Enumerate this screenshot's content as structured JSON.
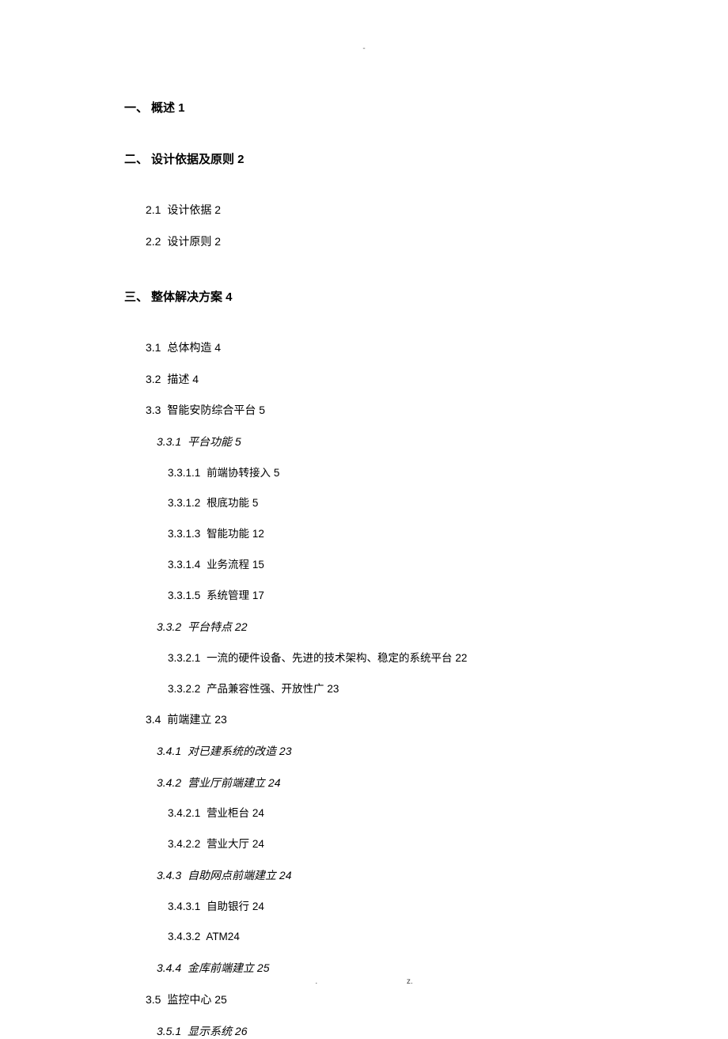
{
  "header": {
    "mark": "-"
  },
  "footer": {
    "dot": ".",
    "z": "z."
  },
  "toc": [
    {
      "level": "h1",
      "num": "一、",
      "title": "概述 1"
    },
    {
      "level": "h1",
      "num": "二、",
      "title": "设计依据及原则 2"
    },
    {
      "level": "l2",
      "num": "2.1",
      "title": "设计依据 2"
    },
    {
      "level": "l2",
      "num": "2.2",
      "title": "设计原则 2"
    },
    {
      "level": "h1",
      "num": "三、",
      "title": "整体解决方案 4"
    },
    {
      "level": "l2",
      "num": "3.1",
      "title": "总体构造 4"
    },
    {
      "level": "l2",
      "num": "3.2",
      "title": "描述 4"
    },
    {
      "level": "l2",
      "num": "3.3",
      "title": "智能安防综合平台 5"
    },
    {
      "level": "l3-italic",
      "num": "3.3.1",
      "title": "平台功能 5"
    },
    {
      "level": "l4",
      "num": "3.3.1.1",
      "title": "前端协转接入 5"
    },
    {
      "level": "l4",
      "num": "3.3.1.2",
      "title": "根底功能 5"
    },
    {
      "level": "l4",
      "num": "3.3.1.3",
      "title": "智能功能 12"
    },
    {
      "level": "l4",
      "num": "3.3.1.4",
      "title": "业务流程 15"
    },
    {
      "level": "l4",
      "num": "3.3.1.5",
      "title": "系统管理 17"
    },
    {
      "level": "l3-italic",
      "num": "3.3.2",
      "title": "平台特点 22"
    },
    {
      "level": "l4",
      "num": "3.3.2.1",
      "title": "一流的硬件设备、先进的技术架构、稳定的系统平台 22"
    },
    {
      "level": "l4",
      "num": "3.3.2.2",
      "title": "产品兼容性强、开放性广 23"
    },
    {
      "level": "l2",
      "num": "3.4",
      "title": "前端建立 23"
    },
    {
      "level": "l3-italic",
      "num": "3.4.1",
      "title": "对已建系统的改造 23"
    },
    {
      "level": "l3-italic",
      "num": "3.4.2",
      "title": "营业厅前端建立 24"
    },
    {
      "level": "l4",
      "num": "3.4.2.1",
      "title": "营业柜台 24"
    },
    {
      "level": "l4",
      "num": "3.4.2.2",
      "title": "营业大厅 24"
    },
    {
      "level": "l3-italic",
      "num": "3.4.3",
      "title": "自助网点前端建立 24"
    },
    {
      "level": "l4",
      "num": "3.4.3.1",
      "title": "自助银行 24"
    },
    {
      "level": "l4",
      "num": "3.4.3.2",
      "title": "ATM24"
    },
    {
      "level": "l3-italic",
      "num": "3.4.4",
      "title": "金库前端建立 25"
    },
    {
      "level": "l2",
      "num": "3.5",
      "title": "监控中心 25"
    },
    {
      "level": "l3-italic",
      "num": "3.5.1",
      "title": "显示系统 26"
    }
  ]
}
